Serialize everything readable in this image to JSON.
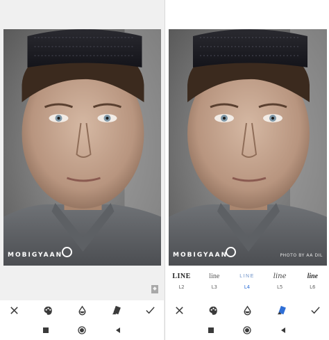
{
  "left_screen": {
    "watermark": "MOBIGYAAN",
    "toolbar_icons": [
      "close-icon",
      "palette-icon",
      "drop-icon",
      "style-icon",
      "check-icon"
    ],
    "bookmark_icon": "bookmark-star-icon"
  },
  "right_screen": {
    "watermark": "MOBIGYAAN",
    "credit": "PHOTO BY AA DIL",
    "text_styles": [
      {
        "sample": "LINE",
        "label": "L2"
      },
      {
        "sample": "line",
        "label": "L3"
      },
      {
        "sample": "LINE",
        "label": "L4",
        "selected": true
      },
      {
        "sample": "line",
        "label": "L5"
      },
      {
        "sample": "line",
        "label": "L6"
      }
    ],
    "toolbar_icons": [
      "close-icon",
      "palette-icon",
      "drop-icon",
      "style-icon-active",
      "check-icon"
    ]
  },
  "nav_icons": [
    "stop-icon",
    "home-icon",
    "back-icon"
  ],
  "colors": {
    "accent": "#2f6fd6",
    "icon": "#3a3a3a",
    "panel_bg": "#f0f0f0"
  }
}
